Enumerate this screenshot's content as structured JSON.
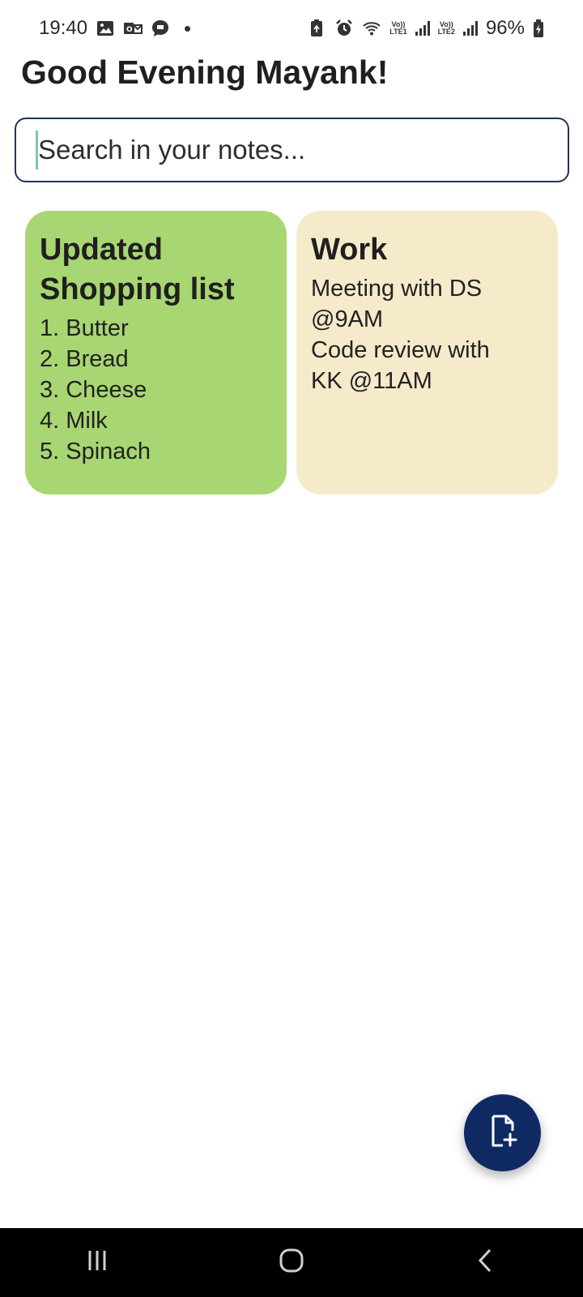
{
  "status_bar": {
    "time": "19:40",
    "left_icons": [
      "image-icon",
      "outlook-icon",
      "chat-icon",
      "dot-icon"
    ],
    "right_icons": [
      "battery-saver-icon",
      "alarm-icon",
      "wifi-icon",
      "signal-lte1-icon",
      "signal-lte2-icon",
      "battery-charging-icon"
    ],
    "net1_top": "Vo))",
    "net1_bottom": "LTE1",
    "net2_top": "Vo))",
    "net2_bottom": "LTE2",
    "battery": "96%"
  },
  "greeting": "Good Evening Mayank!",
  "search": {
    "placeholder": "Search in your notes...",
    "value": ""
  },
  "notes": [
    {
      "title_line1": "Updated",
      "title_line2": "Shopping list",
      "lines": [
        "1. Butter",
        "2. Bread",
        "3. Cheese",
        "4. Milk",
        "5. Spinach"
      ],
      "color": "#a8d672"
    },
    {
      "title_line1": "Work",
      "lines": [
        "Meeting with DS",
        "@9AM",
        "Code review with",
        "KK @11AM"
      ],
      "color": "#f5eaca"
    }
  ],
  "fab": {
    "icon": "add-note-icon",
    "color": "#0f2a63"
  },
  "nav_bar": {
    "icons": [
      "recent-apps-icon",
      "home-icon",
      "back-icon"
    ]
  }
}
